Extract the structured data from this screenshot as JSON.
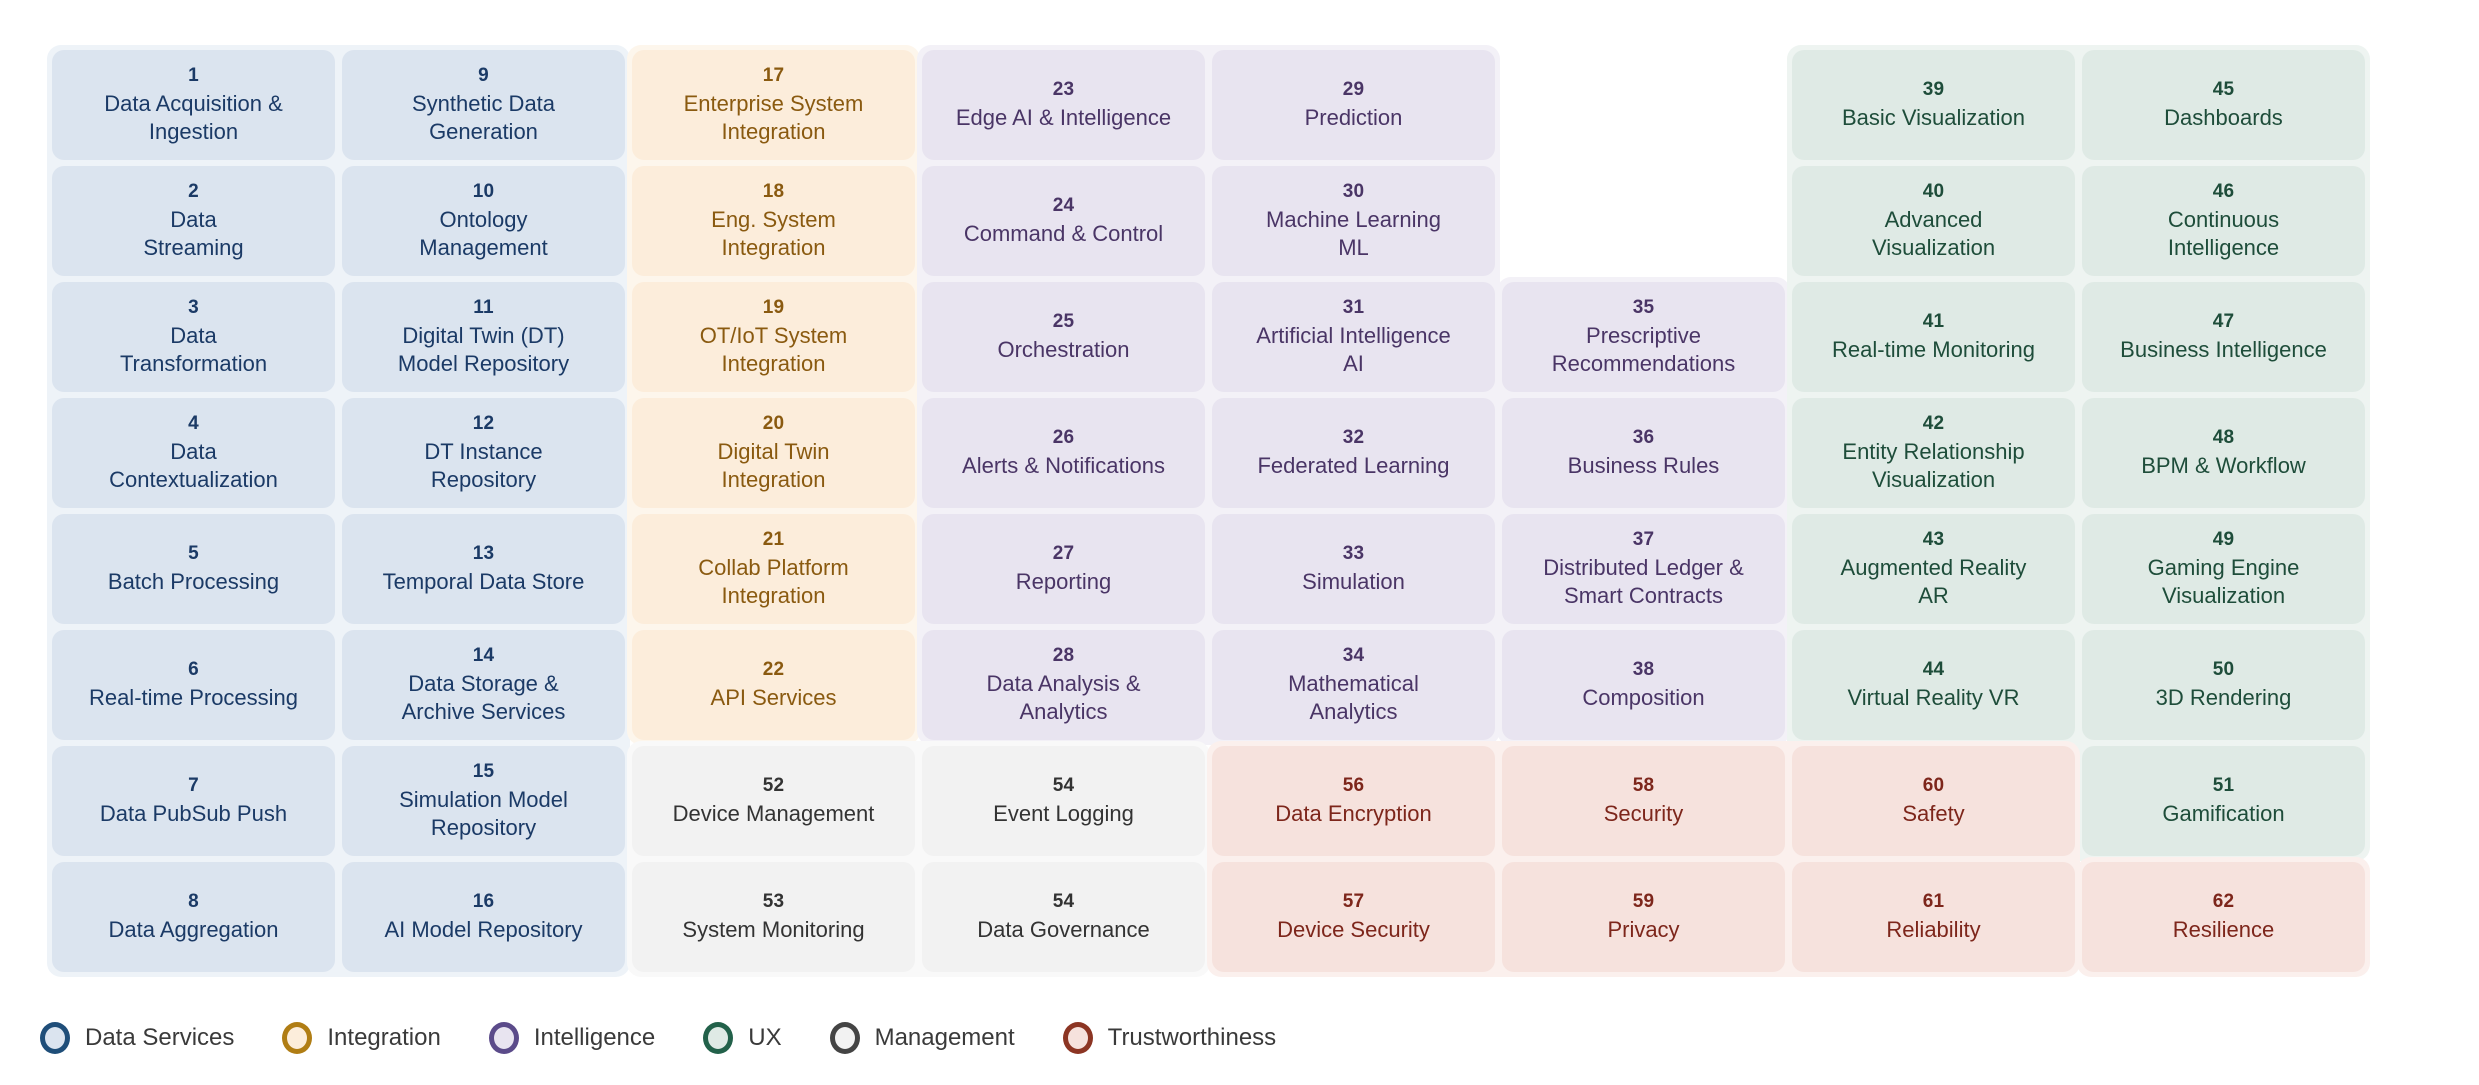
{
  "diagram": {
    "rows": 8,
    "cols": 8,
    "categories": {
      "data": {
        "key": "data",
        "legend_label": "Data Services",
        "accent": "#1f4e79",
        "fill": "#dbe4ef",
        "plate": "#eef3f8",
        "text": "#1b3a66"
      },
      "integration": {
        "key": "integration",
        "legend_label": "Integration",
        "accent": "#b07d14",
        "fill": "#fceddb",
        "plate": "#fdf6ec",
        "text": "#8a5a10"
      },
      "intelligence": {
        "key": "intelligence",
        "legend_label": "Intelligence",
        "accent": "#5b4b8a",
        "fill": "#e8e4f0",
        "plate": "#f3f1f7",
        "text": "#4a3566"
      },
      "ux": {
        "key": "ux",
        "legend_label": "UX",
        "accent": "#22614a",
        "fill": "#dfeae5",
        "plate": "#eef4f1",
        "text": "#1e4d3a"
      },
      "management": {
        "key": "management",
        "legend_label": "Management",
        "accent": "#444444",
        "fill": "#f2f2f2",
        "plate": "#f9f9f9",
        "text": "#333333"
      },
      "trust": {
        "key": "trust",
        "legend_label": "Trustworthiness",
        "accent": "#8c3523",
        "fill": "#f6e2dd",
        "plate": "#fbf0ed",
        "text": "#7d261b"
      }
    },
    "legend": [
      {
        "id": "legend-data",
        "label": "Data Services",
        "category": "data"
      },
      {
        "id": "legend-integration",
        "label": "Integration",
        "category": "integration"
      },
      {
        "id": "legend-intelligence",
        "label": "Intelligence",
        "category": "intelligence"
      },
      {
        "id": "legend-ux",
        "label": "UX",
        "category": "ux"
      },
      {
        "id": "legend-management",
        "label": "Management",
        "category": "management"
      },
      {
        "id": "legend-trustworthiness",
        "label": "Trustworthiness",
        "category": "trust"
      }
    ],
    "plates": [
      {
        "name": "plate-data",
        "category": "data",
        "col": 1,
        "colspan": 2,
        "row": 1,
        "rowspan": 8
      },
      {
        "name": "plate-integration",
        "category": "integration",
        "col": 3,
        "colspan": 1,
        "row": 1,
        "rowspan": 6
      },
      {
        "name": "plate-intelligence-a",
        "category": "intelligence",
        "col": 4,
        "colspan": 2,
        "row": 1,
        "rowspan": 6
      },
      {
        "name": "plate-intelligence-b",
        "category": "intelligence",
        "col": 6,
        "colspan": 1,
        "row": 3,
        "rowspan": 4
      },
      {
        "name": "plate-ux",
        "category": "ux",
        "col": 7,
        "colspan": 2,
        "row": 1,
        "rowspan": 7
      },
      {
        "name": "plate-management",
        "category": "management",
        "col": 3,
        "colspan": 2,
        "row": 7,
        "rowspan": 2
      },
      {
        "name": "plate-trust",
        "category": "trust",
        "col": 5,
        "colspan": 3,
        "row": 7,
        "rowspan": 2
      },
      {
        "name": "plate-trust-last",
        "category": "trust",
        "col": 8,
        "colspan": 1,
        "row": 8,
        "rowspan": 1
      }
    ],
    "cells": [
      {
        "num": "1",
        "label": "Data Acquisition &\nIngestion",
        "category": "data",
        "col": 1,
        "row": 1
      },
      {
        "num": "2",
        "label": "Data\nStreaming",
        "category": "data",
        "col": 1,
        "row": 2
      },
      {
        "num": "3",
        "label": "Data\nTransformation",
        "category": "data",
        "col": 1,
        "row": 3
      },
      {
        "num": "4",
        "label": "Data\nContextualization",
        "category": "data",
        "col": 1,
        "row": 4
      },
      {
        "num": "5",
        "label": "Batch Processing",
        "category": "data",
        "col": 1,
        "row": 5
      },
      {
        "num": "6",
        "label": "Real-time Processing",
        "category": "data",
        "col": 1,
        "row": 6
      },
      {
        "num": "7",
        "label": "Data PubSub Push",
        "category": "data",
        "col": 1,
        "row": 7
      },
      {
        "num": "8",
        "label": "Data Aggregation",
        "category": "data",
        "col": 1,
        "row": 8
      },
      {
        "num": "9",
        "label": "Synthetic Data\nGeneration",
        "category": "data",
        "col": 2,
        "row": 1
      },
      {
        "num": "10",
        "label": "Ontology\nManagement",
        "category": "data",
        "col": 2,
        "row": 2
      },
      {
        "num": "11",
        "label": "Digital Twin (DT)\nModel Repository",
        "category": "data",
        "col": 2,
        "row": 3
      },
      {
        "num": "12",
        "label": "DT Instance\nRepository",
        "category": "data",
        "col": 2,
        "row": 4
      },
      {
        "num": "13",
        "label": "Temporal Data Store",
        "category": "data",
        "col": 2,
        "row": 5
      },
      {
        "num": "14",
        "label": "Data Storage &\nArchive Services",
        "category": "data",
        "col": 2,
        "row": 6
      },
      {
        "num": "15",
        "label": "Simulation Model\nRepository",
        "category": "data",
        "col": 2,
        "row": 7
      },
      {
        "num": "16",
        "label": "AI Model Repository",
        "category": "data",
        "col": 2,
        "row": 8
      },
      {
        "num": "17",
        "label": "Enterprise System\nIntegration",
        "category": "integration",
        "col": 3,
        "row": 1
      },
      {
        "num": "18",
        "label": "Eng. System\nIntegration",
        "category": "integration",
        "col": 3,
        "row": 2
      },
      {
        "num": "19",
        "label": "OT/IoT System\nIntegration",
        "category": "integration",
        "col": 3,
        "row": 3
      },
      {
        "num": "20",
        "label": "Digital Twin\nIntegration",
        "category": "integration",
        "col": 3,
        "row": 4
      },
      {
        "num": "21",
        "label": "Collab Platform\nIntegration",
        "category": "integration",
        "col": 3,
        "row": 5
      },
      {
        "num": "22",
        "label": "API Services",
        "category": "integration",
        "col": 3,
        "row": 6
      },
      {
        "num": "52",
        "label": "Device Management",
        "category": "management",
        "col": 3,
        "row": 7
      },
      {
        "num": "53",
        "label": "System Monitoring",
        "category": "management",
        "col": 3,
        "row": 8
      },
      {
        "num": "23",
        "label": "Edge AI & Intelligence",
        "category": "intelligence",
        "col": 4,
        "row": 1
      },
      {
        "num": "24",
        "label": "Command & Control",
        "category": "intelligence",
        "col": 4,
        "row": 2
      },
      {
        "num": "25",
        "label": "Orchestration",
        "category": "intelligence",
        "col": 4,
        "row": 3
      },
      {
        "num": "26",
        "label": "Alerts & Notifications",
        "category": "intelligence",
        "col": 4,
        "row": 4
      },
      {
        "num": "27",
        "label": "Reporting",
        "category": "intelligence",
        "col": 4,
        "row": 5
      },
      {
        "num": "28",
        "label": "Data Analysis &\nAnalytics",
        "category": "intelligence",
        "col": 4,
        "row": 6
      },
      {
        "num": "54",
        "label": "Event Logging",
        "category": "management",
        "col": 4,
        "row": 7
      },
      {
        "num": "54",
        "label": "Data Governance",
        "category": "management",
        "col": 4,
        "row": 8
      },
      {
        "num": "29",
        "label": "Prediction",
        "category": "intelligence",
        "col": 5,
        "row": 1
      },
      {
        "num": "30",
        "label": "Machine Learning\nML",
        "category": "intelligence",
        "col": 5,
        "row": 2
      },
      {
        "num": "31",
        "label": "Artificial Intelligence\nAI",
        "category": "intelligence",
        "col": 5,
        "row": 3
      },
      {
        "num": "32",
        "label": "Federated Learning",
        "category": "intelligence",
        "col": 5,
        "row": 4
      },
      {
        "num": "33",
        "label": "Simulation",
        "category": "intelligence",
        "col": 5,
        "row": 5
      },
      {
        "num": "34",
        "label": "Mathematical\nAnalytics",
        "category": "intelligence",
        "col": 5,
        "row": 6
      },
      {
        "num": "56",
        "label": "Data Encryption",
        "category": "trust",
        "col": 5,
        "row": 7
      },
      {
        "num": "57",
        "label": "Device Security",
        "category": "trust",
        "col": 5,
        "row": 8
      },
      {
        "num": "35",
        "label": "Prescriptive\nRecommendations",
        "category": "intelligence",
        "col": 6,
        "row": 3
      },
      {
        "num": "36",
        "label": "Business Rules",
        "category": "intelligence",
        "col": 6,
        "row": 4
      },
      {
        "num": "37",
        "label": "Distributed Ledger &\nSmart Contracts",
        "category": "intelligence",
        "col": 6,
        "row": 5
      },
      {
        "num": "38",
        "label": "Composition",
        "category": "intelligence",
        "col": 6,
        "row": 6
      },
      {
        "num": "58",
        "label": "Security",
        "category": "trust",
        "col": 6,
        "row": 7
      },
      {
        "num": "59",
        "label": "Privacy",
        "category": "trust",
        "col": 6,
        "row": 8
      },
      {
        "num": "39",
        "label": "Basic Visualization",
        "category": "ux",
        "col": 7,
        "row": 1
      },
      {
        "num": "40",
        "label": "Advanced\nVisualization",
        "category": "ux",
        "col": 7,
        "row": 2
      },
      {
        "num": "41",
        "label": "Real-time Monitoring",
        "category": "ux",
        "col": 7,
        "row": 3
      },
      {
        "num": "42",
        "label": "Entity Relationship\nVisualization",
        "category": "ux",
        "col": 7,
        "row": 4
      },
      {
        "num": "43",
        "label": "Augmented Reality\nAR",
        "category": "ux",
        "col": 7,
        "row": 5
      },
      {
        "num": "44",
        "label": "Virtual Reality VR",
        "category": "ux",
        "col": 7,
        "row": 6
      },
      {
        "num": "60",
        "label": "Safety",
        "category": "trust",
        "col": 7,
        "row": 7
      },
      {
        "num": "61",
        "label": "Reliability",
        "category": "trust",
        "col": 7,
        "row": 8
      },
      {
        "num": "45",
        "label": "Dashboards",
        "category": "ux",
        "col": 8,
        "row": 1
      },
      {
        "num": "46",
        "label": "Continuous\nIntelligence",
        "category": "ux",
        "col": 8,
        "row": 2
      },
      {
        "num": "47",
        "label": "Business Intelligence",
        "category": "ux",
        "col": 8,
        "row": 3
      },
      {
        "num": "48",
        "label": "BPM & Workflow",
        "category": "ux",
        "col": 8,
        "row": 4
      },
      {
        "num": "49",
        "label": "Gaming Engine\nVisualization",
        "category": "ux",
        "col": 8,
        "row": 5
      },
      {
        "num": "50",
        "label": "3D Rendering",
        "category": "ux",
        "col": 8,
        "row": 6
      },
      {
        "num": "51",
        "label": "Gamification",
        "category": "ux",
        "col": 8,
        "row": 7
      },
      {
        "num": "62",
        "label": "Resilience",
        "category": "trust",
        "col": 8,
        "row": 8
      }
    ]
  }
}
